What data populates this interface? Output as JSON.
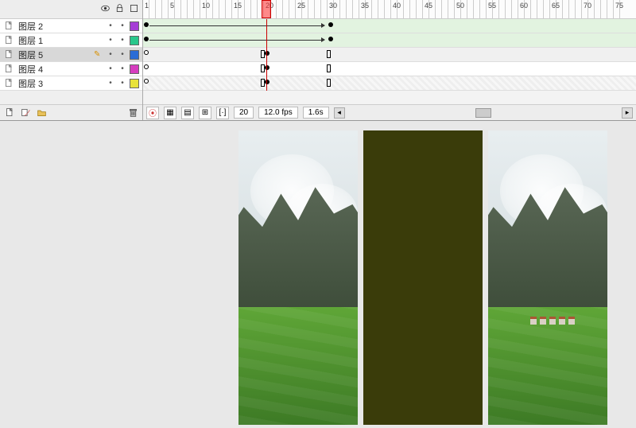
{
  "header_icons": {
    "eye": "eye-icon",
    "lock": "lock-icon",
    "outline": "outline-icon"
  },
  "layers": [
    {
      "name": "图层 2",
      "selected": false,
      "pencil": false,
      "swatch": "#a63dd6",
      "track": "tween"
    },
    {
      "name": "图层 1",
      "selected": false,
      "pencil": false,
      "swatch": "#29c78b",
      "track": "tween"
    },
    {
      "name": "图层 5",
      "selected": true,
      "pencil": true,
      "swatch": "#2b6cd6",
      "track": "plain"
    },
    {
      "name": "图层 4",
      "selected": false,
      "pencil": false,
      "swatch": "#d63dbf",
      "track": "plain"
    },
    {
      "name": "图层 3",
      "selected": false,
      "pencil": false,
      "swatch": "#e8e23a",
      "track": "mask"
    }
  ],
  "footer_buttons": {
    "new_layer": "new-layer-icon",
    "new_motion": "new-motion-icon",
    "new_folder": "new-folder-icon",
    "delete": "trash-icon"
  },
  "ruler": {
    "start": 1,
    "end": 75,
    "step": 5
  },
  "playhead_frame": 20,
  "frame_span_start": 1,
  "frame_span_end": 30,
  "timeline_footer": {
    "current_frame": "20",
    "fps": "12.0 fps",
    "time": "1.6s"
  },
  "stage": {
    "panels": [
      {
        "type": "scene",
        "variant": "left"
      },
      {
        "type": "olive"
      },
      {
        "type": "scene",
        "variant": "right"
      }
    ]
  }
}
